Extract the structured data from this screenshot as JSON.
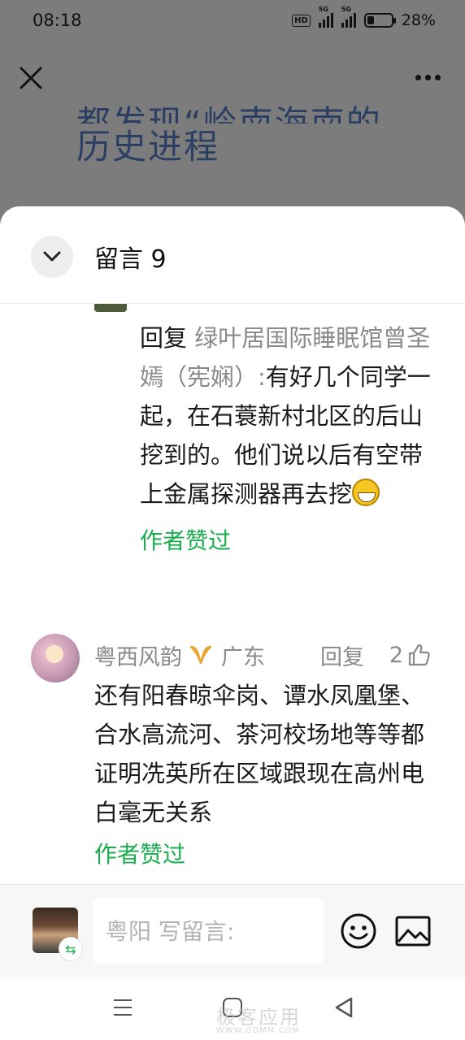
{
  "status_bar": {
    "time": "08:18",
    "hd_label": "HD",
    "network_1": "5G",
    "network_2": "5G",
    "battery_percent": "28%",
    "battery_level": 0.28
  },
  "article": {
    "title_line_partial": "都发现“岭南海南的",
    "title_line_2": "历史进程"
  },
  "sheet": {
    "title": "留言 9"
  },
  "reply": {
    "prefix": "回复",
    "target": "绿叶居国际睡眠馆曾圣嫣（宪娴）:",
    "text": "有好几个同学一起，在石蓑新村北区的后山挖到的。他们说以后有空带上金属探测器再去挖",
    "author_liked": "作者赞过"
  },
  "comment": {
    "name": "粤西风韵",
    "region": "广东",
    "reply_label": "回复",
    "likes": "2",
    "text": "还有阳春晾伞岗、谭水凤凰堡、合水高流河、茶河校场地等等都证明冼英所在区域跟现在高州电白毫无关系",
    "author_liked": "作者赞过"
  },
  "input_bar": {
    "placeholder": "粤阳 写留言:"
  },
  "watermark": {
    "text": "极客应用",
    "url": "WWW.GDMM.COM"
  },
  "icons": {
    "close": "close-icon",
    "more": "more-icon",
    "collapse": "chevron-down-icon",
    "badge": "ribbon-badge-icon",
    "like": "thumbs-up-icon",
    "switch": "switch-icon",
    "emoji": "emoji-icon",
    "image": "image-icon",
    "nav_menu": "menu-icon",
    "nav_home": "home-icon",
    "nav_back": "back-icon"
  },
  "colors": {
    "accent_green": "#1aad4e",
    "title_blue": "#2b3f63",
    "dim_overlay": "#7c7c7c"
  }
}
